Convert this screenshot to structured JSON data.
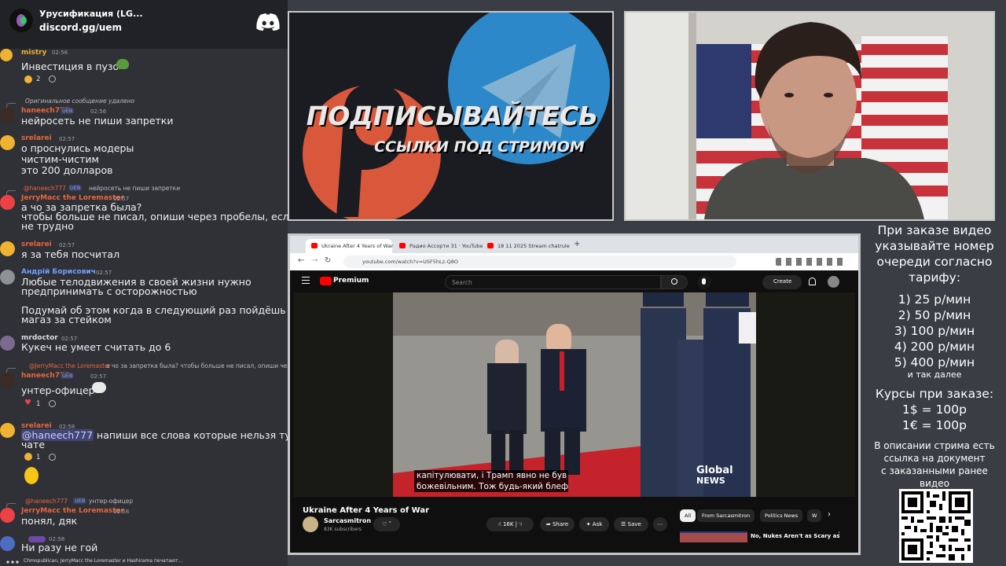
{
  "server": {
    "name": "Урусификация (LG...",
    "invite": "discord.gg/uem"
  },
  "chat": {
    "messages": [
      {
        "name": "mistry",
        "time": "02:56",
        "text": [
          "Инвестиция в пузо"
        ],
        "reaction_count": "2"
      },
      {
        "reply": "Оригинальное сообщение удалено",
        "name": "haneech777",
        "badge": "UEB",
        "time": "02:56",
        "text": [
          "нейросеть не пиши запретки"
        ]
      },
      {
        "name": "srelarei",
        "time": "02:57",
        "text": [
          "о проснулись модеры",
          "чистим-чистим",
          "это 200 долларов"
        ]
      },
      {
        "reply_name": "@haneech777",
        "reply_badge": "UEB",
        "reply": "нейросеть не пиши запретки",
        "name": "JerryMacc the Loremaster",
        "time": "02:57",
        "text": [
          "а чо за запретка была?",
          "чтобы больше не писал, опиши через пробелы, если",
          "не трудно"
        ]
      },
      {
        "name": "srelarei",
        "time": "02:57",
        "text": [
          "я за тебя посчитал"
        ]
      },
      {
        "name": "Андрій Борисович",
        "time": "02:57",
        "text": [
          "Любые телодвижения в своей жизни нужно",
          "предпринимать с осторожностью",
          "",
          "Подумай об этом когда в следующий раз пойдёшь в",
          "магаз за стейком"
        ]
      },
      {
        "name": "mrdoctor",
        "time": "02:57",
        "text": [
          "Кукеч не умеет считать до 6"
        ]
      },
      {
        "reply_name": "@JerryMacc the Loremaster",
        "reply": "а чо за запретка была? чтобы больше не писал, опиши через пробе...",
        "name": "haneech777",
        "badge": "UEB",
        "time": "02:57",
        "text": [
          "унтер-офицер"
        ],
        "reaction_count": "1"
      },
      {
        "name": "srelarei",
        "time": "02:58",
        "mention": "@haneech777",
        "text": [
          "напиши все слова которые нельзя тут в",
          "чате"
        ],
        "reaction_count": "1"
      },
      {
        "reply_name": "@haneech777",
        "reply_badge": "UEB",
        "reply": "унтер-офицер",
        "name": "JerryMacc the Loremaster",
        "time": "02:58",
        "text": [
          "понял, дяк"
        ]
      },
      {
        "name": "",
        "time": "02:58",
        "text": [
          "Ни разу не гой"
        ]
      }
    ],
    "typing": "Chmopublican, JerryMacc the Loremaster и Hashirama печатают..."
  },
  "promo": {
    "title": "ПОДПИСЫВАЙТЕСЬ",
    "subtitle": "ССЫЛКИ ПОД СТРИМОМ"
  },
  "browser": {
    "tabs": [
      "Ukraine After 4 Years of War",
      "Радио Ассорти 31 · YouTube",
      "18 11 2025 Stream chatrule"
    ],
    "url": "youtube.com/watch?v=USF5hLz-Q8O",
    "logo": "Premium",
    "search_placeholder": "Search",
    "create_label": "Create",
    "subtitle_lines": [
      "капітулювати, і Трамп явно не був",
      "божевільним.  Тож будь-який блеф"
    ],
    "watermark": [
      "Global",
      "NEWS"
    ],
    "video_title": "Ukraine After 4 Years of War",
    "channel_name": "Sarcasmitron",
    "channel_subs": "83K subscribers",
    "likes": "16K",
    "share": "Share",
    "ask": "Ask",
    "save": "Save",
    "chips": [
      "All",
      "From Sarcasmitron",
      "Politics News",
      "W"
    ],
    "rec_title": "No, Nukes Aren't as Scary as"
  },
  "sidebar": {
    "order_text": [
      "При заказе видео",
      "указывайте номер",
      "очереди согласно",
      "тарифу:"
    ],
    "tariffs": [
      "1) 25 р/мин",
      "2) 50 р/мин",
      "3) 100 р/мин",
      "4) 200 р/мин",
      "5) 400 р/мин"
    ],
    "etc": "и так далее",
    "rates_title": "Курсы при заказе:",
    "rates": [
      "1$ = 100р",
      "1€ = 100р"
    ],
    "desc": [
      "В описании стрима есть",
      "ссылка на документ",
      "с заказанными ранее",
      "видео"
    ]
  },
  "colors": {
    "chat_bg": "#2f3136",
    "header_bg": "#202225",
    "discord_blurple": "#5865f2",
    "name_red": "#e8663d",
    "name_blue": "#6fa0ff",
    "name_yellow": "#f0b232"
  }
}
